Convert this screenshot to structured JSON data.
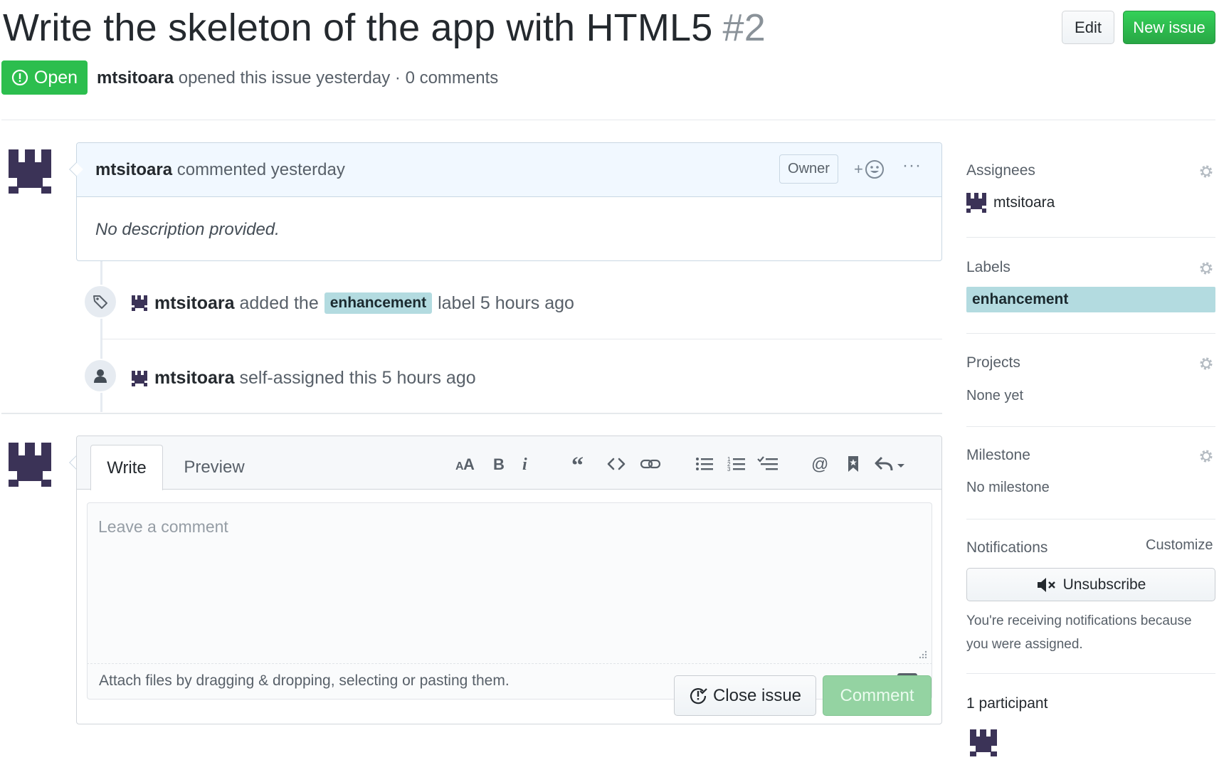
{
  "header": {
    "title": "Write the skeleton of the app with HTML5",
    "issue_number": "#2",
    "edit_label": "Edit",
    "new_issue_label": "New issue",
    "state_label": "Open",
    "author": "mtsitoara",
    "meta_text": "opened this issue yesterday · 0 comments"
  },
  "comment": {
    "author": "mtsitoara",
    "action": "commented yesterday",
    "badge": "Owner",
    "reaction_symbol": "+",
    "more_symbol": "···",
    "body": "No description provided."
  },
  "timeline": [
    {
      "icon": "tag-icon",
      "author": "mtsitoara",
      "before": "added the",
      "label": "enhancement",
      "after": "label 5 hours ago"
    },
    {
      "icon": "person-icon",
      "author": "mtsitoara",
      "text": "self-assigned this 5 hours ago"
    }
  ],
  "editor": {
    "tabs": [
      "Write",
      "Preview"
    ],
    "active_tab": "Write",
    "placeholder": "Leave a comment",
    "attach_text": "Attach files by dragging & dropping, selecting or pasting them.",
    "markdown_badge": "M↓",
    "toolbar": [
      "header-icon",
      "bold-icon",
      "italic-icon",
      "quote-icon",
      "code-icon",
      "link-icon",
      "unordered-list-icon",
      "ordered-list-icon",
      "task-list-icon",
      "mention-icon",
      "saved-reply-icon",
      "reply-icon"
    ],
    "close_issue_label": "Close issue",
    "comment_label": "Comment"
  },
  "sidebar": {
    "assignees_heading": "Assignees",
    "assignee": "mtsitoara",
    "labels_heading": "Labels",
    "label": "enhancement",
    "projects_heading": "Projects",
    "projects_value": "None yet",
    "milestone_heading": "Milestone",
    "milestone_value": "No milestone",
    "notifications_heading": "Notifications",
    "customize_label": "Customize",
    "unsubscribe_label": "Unsubscribe",
    "notification_reason": "You're receiving notifications because you were assigned.",
    "participants_heading": "1 participant"
  },
  "colors": {
    "open_green": "#2cbe4e",
    "new_issue_green": "#28a745",
    "label_color": "#b3dbe0",
    "comment_header_bg": "#f1f8ff",
    "avatar_color": "#3b3357"
  }
}
